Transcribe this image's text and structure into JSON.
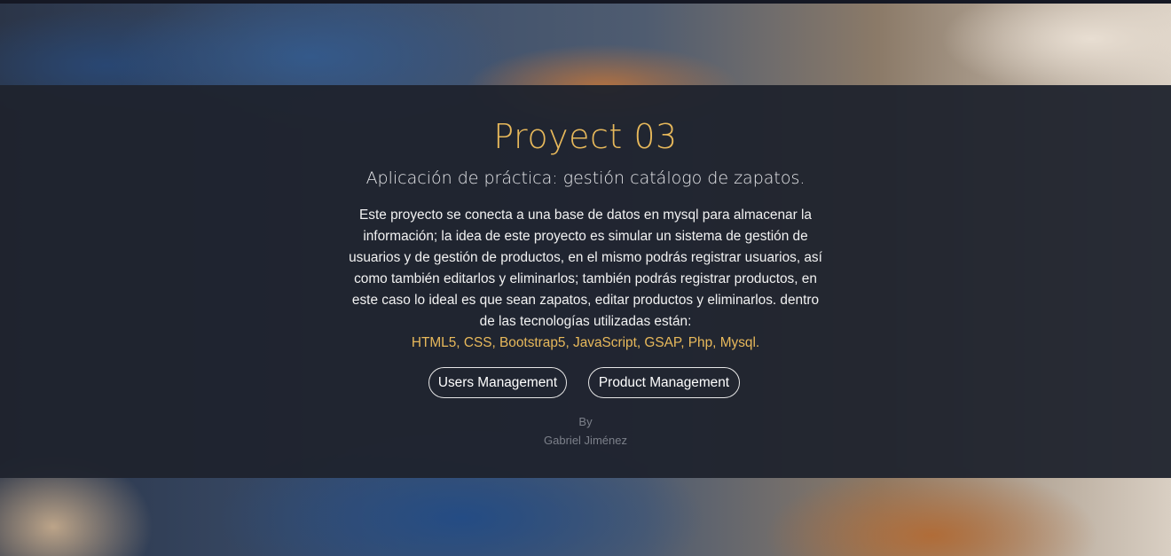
{
  "hero": {
    "title": "Proyect 03",
    "subtitle": "Aplicación de práctica: gestión catálogo de zapatos.",
    "description": "Este proyecto se conecta a una base de datos en mysql para almacenar la información; la idea de este proyecto es simular un sistema de gestión de usuarios y de gestión de productos, en el mismo podrás registrar usuarios, así como también editarlos y eliminarlos; también podrás registrar productos, en este caso lo ideal es que sean zapatos, editar productos y eliminarlos. dentro de las tecnologías utilizadas están:",
    "technologies": "HTML5, CSS, Bootstrap5, JavaScript, GSAP, Php, Mysql.",
    "buttons": {
      "users_label": "Users Management",
      "products_label": "Product Management"
    },
    "by_label": "By",
    "author": "Gabriel Jiménez"
  },
  "colors": {
    "accent": "#e8b95b",
    "overlay": "#1f232d",
    "text": "#f2f2f2",
    "muted": "#7c808a"
  }
}
